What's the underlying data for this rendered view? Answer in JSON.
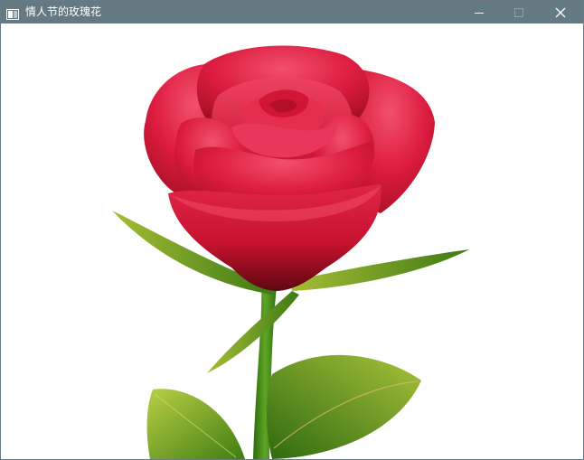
{
  "window": {
    "title": "情人节的玫瑰花",
    "icon": "app-window-icon",
    "controls": [
      "minimize-icon",
      "maximize-icon",
      "close-icon"
    ]
  },
  "canvas": {
    "subject": "rose",
    "colors": {
      "titlebar": "#647a82",
      "petal_light": "#ec3d5e",
      "petal_mid": "#d9193d",
      "petal_dark": "#6b0912",
      "leaf_light": "#a8c43a",
      "leaf_dark": "#2d6b10",
      "stem": "#3d8a1a"
    }
  }
}
